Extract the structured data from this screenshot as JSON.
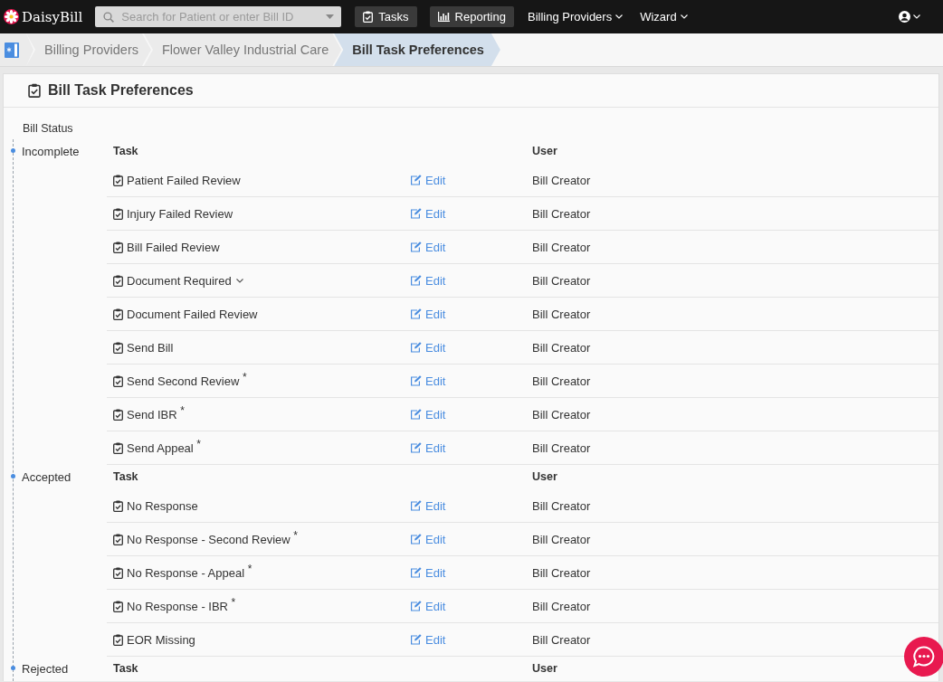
{
  "navbar": {
    "logo": "DaisyBill",
    "search": {
      "placeholder": "Search for Patient or enter Bill ID"
    },
    "buttons": [
      "Tasks",
      "Reporting"
    ],
    "menus": [
      "Billing Providers",
      "Wizard"
    ]
  },
  "breadcrumb": [
    {
      "label": "Billing Providers",
      "selected": false
    },
    {
      "label": "Flower Valley Industrial Care",
      "selected": false
    },
    {
      "label": "Bill Task Preferences",
      "selected": true
    }
  ],
  "card": {
    "title": "Bill Task Preferences",
    "status_heading": "Bill Status",
    "groups": [
      {
        "status": "Incomplete",
        "columns": [
          "Task",
          "User"
        ],
        "tasks": [
          {
            "name": "Patient Failed Review",
            "expandable": false,
            "action": "Edit",
            "user": "Bill Creator"
          },
          {
            "name": "Injury Failed Review",
            "expandable": false,
            "action": "Edit",
            "user": "Bill Creator"
          },
          {
            "name": "Bill Failed Review",
            "expandable": false,
            "action": "Edit",
            "user": "Bill Creator"
          },
          {
            "name": "Document Required",
            "expandable": true,
            "action": "Edit",
            "user": "Bill Creator"
          },
          {
            "name": "Document Failed Review",
            "expandable": false,
            "action": "Edit",
            "user": "Bill Creator"
          },
          {
            "name": "Send Bill",
            "expandable": false,
            "action": "Edit",
            "user": "Bill Creator"
          },
          {
            "name": "Send Second Review $^{*}$",
            "expandable": false,
            "action": "Edit",
            "user": "Bill Creator"
          },
          {
            "name": "Send IBR $^{*}$",
            "expandable": false,
            "action": "Edit",
            "user": "Bill Creator"
          },
          {
            "name": "Send Appeal $^{*}$",
            "expandable": false,
            "action": "Edit",
            "user": "Bill Creator"
          }
        ]
      },
      {
        "status": "Accepted",
        "columns": [
          "Task",
          "User"
        ],
        "tasks": [
          {
            "name": "No Response",
            "expandable": false,
            "action": "Edit",
            "user": "Bill Creator"
          },
          {
            "name": "No Response - Second Review $^{*}$",
            "expandable": false,
            "action": "Edit",
            "user": "Bill Creator"
          },
          {
            "name": "No Response - Appeal $^{*}$",
            "expandable": false,
            "action": "Edit",
            "user": "Bill Creator"
          },
          {
            "name": "No Response - IBR $^{*}$",
            "expandable": false,
            "action": "Edit",
            "user": "Bill Creator"
          },
          {
            "name": "EOR Missing",
            "expandable": false,
            "action": "Edit",
            "user": "Bill Creator"
          }
        ]
      },
      {
        "status": "Rejected",
        "columns": [
          "Task",
          "User"
        ]
      }
    ]
  }
}
